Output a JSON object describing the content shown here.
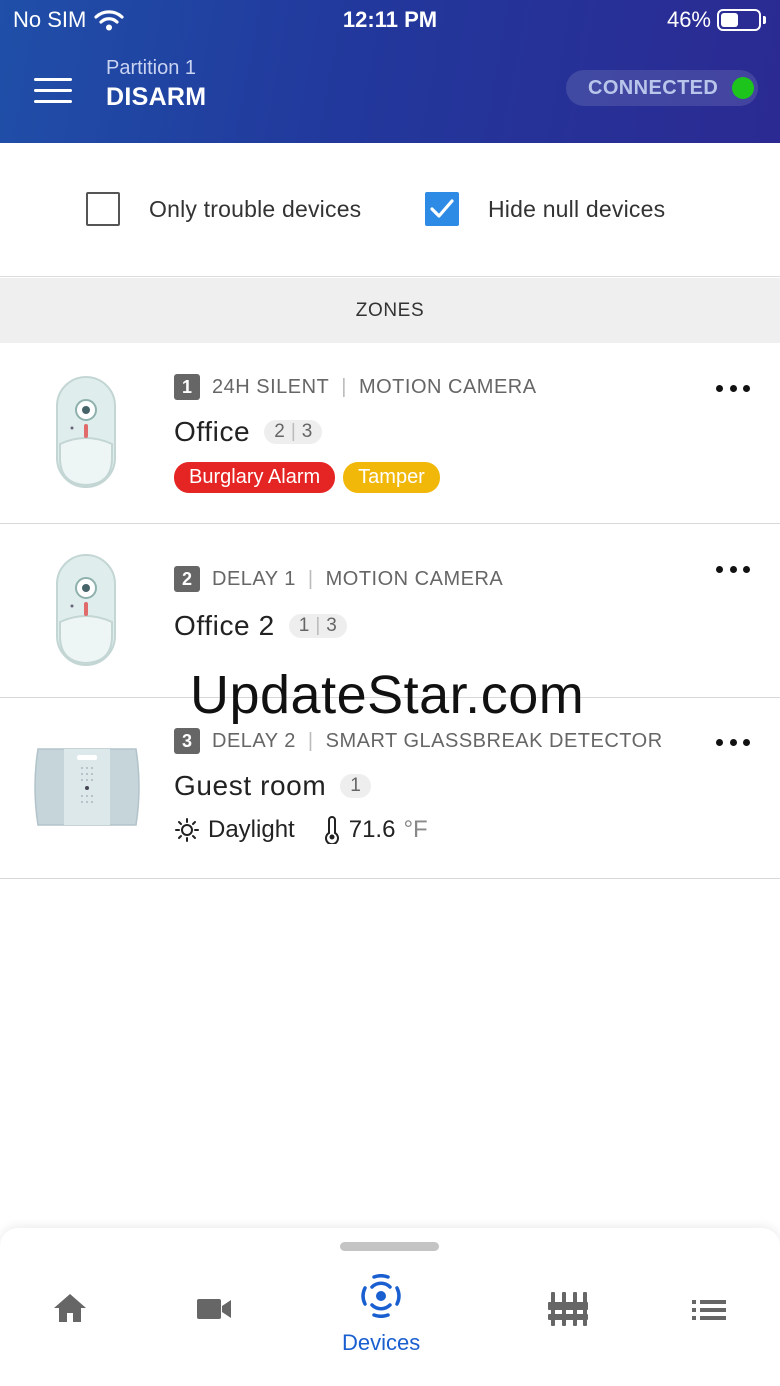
{
  "status_bar": {
    "carrier": "No SIM",
    "time": "12:11 PM",
    "battery": "46%",
    "battery_level": 0.46
  },
  "header": {
    "partition": "Partition 1",
    "arm_state": "DISARM",
    "connection": "CONNECTED",
    "connection_color": "#1cc41c"
  },
  "filters": [
    {
      "label": "Only trouble devices",
      "checked": false
    },
    {
      "label": "Hide null devices",
      "checked": true
    }
  ],
  "section_title": "ZONES",
  "zones": [
    {
      "number": "1",
      "type": "24H SILENT",
      "device": "MOTION CAMERA",
      "name": "Office",
      "partitions": [
        "2",
        "3"
      ],
      "tags": [
        {
          "label": "Burglary Alarm",
          "color": "#e52424"
        },
        {
          "label": "Tamper",
          "color": "#f1b80a"
        }
      ]
    },
    {
      "number": "2",
      "type": "DELAY 1",
      "device": "MOTION CAMERA",
      "name": "Office 2",
      "partitions": [
        "1",
        "3"
      ],
      "tags": []
    },
    {
      "number": "3",
      "type": "DELAY 2",
      "device": "SMART GLASSBREAK DETECTOR",
      "name": "Guest room",
      "partitions": [
        "1"
      ],
      "tags": [],
      "sensors": {
        "light": "Daylight",
        "temperature": "71.6",
        "temperature_unit": "°F"
      }
    }
  ],
  "watermark": "UpdateStar.com",
  "bottom_nav": {
    "items": [
      {
        "icon": "home-icon",
        "label": "",
        "active": false
      },
      {
        "icon": "camera-icon",
        "label": "",
        "active": false
      },
      {
        "icon": "devices-icon",
        "label": "Devices",
        "active": true
      },
      {
        "icon": "equalizer-icon",
        "label": "",
        "active": false
      },
      {
        "icon": "list-icon",
        "label": "",
        "active": false
      }
    ],
    "active_color": "#1a5fd0"
  }
}
